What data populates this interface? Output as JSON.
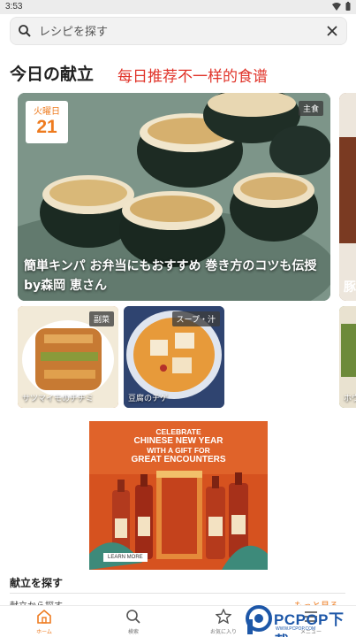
{
  "status_bar": {
    "time": "3:53"
  },
  "search": {
    "placeholder": "レシピを探す"
  },
  "section": {
    "title": "今日の献立",
    "overlay_caption": "每日推荐不一样的食谱"
  },
  "hero": {
    "weekday": "火曜日",
    "day": "21",
    "tag": "主食",
    "title": "簡単キンパ お弁当にもおすすめ 巻き方のコツも伝授 by森岡 恵さん"
  },
  "peek_card": {
    "title_fragment": "豚"
  },
  "small_cards": [
    {
      "tag": "副菜",
      "caption": "サツマイモのチヂミ"
    },
    {
      "tag": "スープ・汁",
      "caption": "豆腐のチゲ"
    },
    {
      "caption": "ホウ"
    }
  ],
  "ad": {
    "line1": "CELEBRATE",
    "line2": "CHINESE NEW YEAR",
    "line3": "WITH A GIFT FOR",
    "line4": "GREAT ENCOUNTERS",
    "cta": "LEARN MORE"
  },
  "find_menu": {
    "title": "献立を探す",
    "row_left": "献立から探す",
    "row_right": "もっと見る"
  },
  "bottom_nav": {
    "home": "ホーム",
    "search": "検索",
    "favorites": "お気に入り",
    "menu": "メニュー"
  },
  "watermark": {
    "text": "PCPOP下载",
    "sub": "WWW.PCPOP.COM"
  },
  "colors": {
    "accent": "#ee7b1f",
    "caption_red": "#e0342a",
    "watermark_blue": "#1d57a8"
  }
}
